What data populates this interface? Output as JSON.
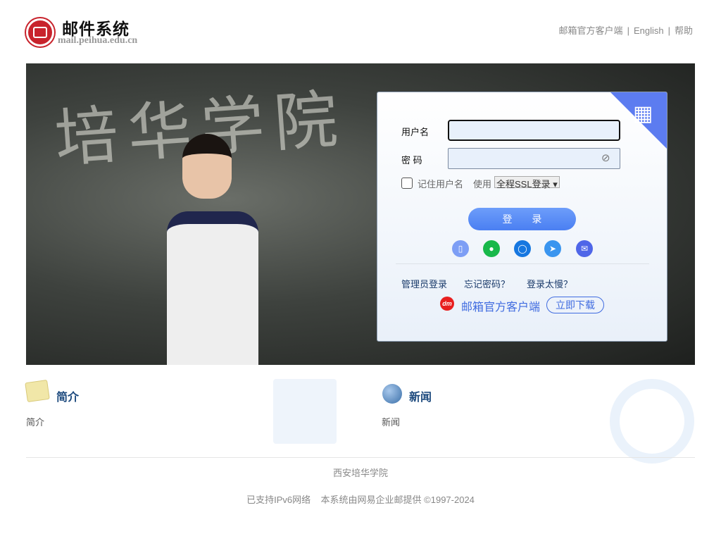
{
  "header": {
    "logo_title": "邮件系统",
    "logo_domain": "mail.peihua.edu.cn",
    "links": [
      "邮箱官方客户端",
      "English",
      "帮助"
    ]
  },
  "banner": {
    "chalk_text": "培华学院"
  },
  "login": {
    "username_label": "用户名",
    "password_label": "密 码",
    "username_value": "",
    "password_value": "",
    "remember_label": "记住用户名",
    "use_label": "使用",
    "ssl_option": "全程SSL登录",
    "login_button": "登 录",
    "social_icons": [
      "phone-icon",
      "wechat-icon",
      "chat-icon",
      "paper-plane-icon",
      "mail-client-icon"
    ],
    "links": [
      "管理员登录",
      "忘记密码？",
      "登录太慢？"
    ],
    "client_label": "邮箱官方客户端",
    "download_button": "立即下载"
  },
  "sections": [
    {
      "title": "简介",
      "body": "简介"
    },
    {
      "title": "新闻",
      "body": "新闻"
    }
  ],
  "footer": {
    "org": "西安培华学院",
    "ipv6": "已支持IPv6网络",
    "provider": "本系统由网易企业邮提供 ©1997-2024"
  }
}
